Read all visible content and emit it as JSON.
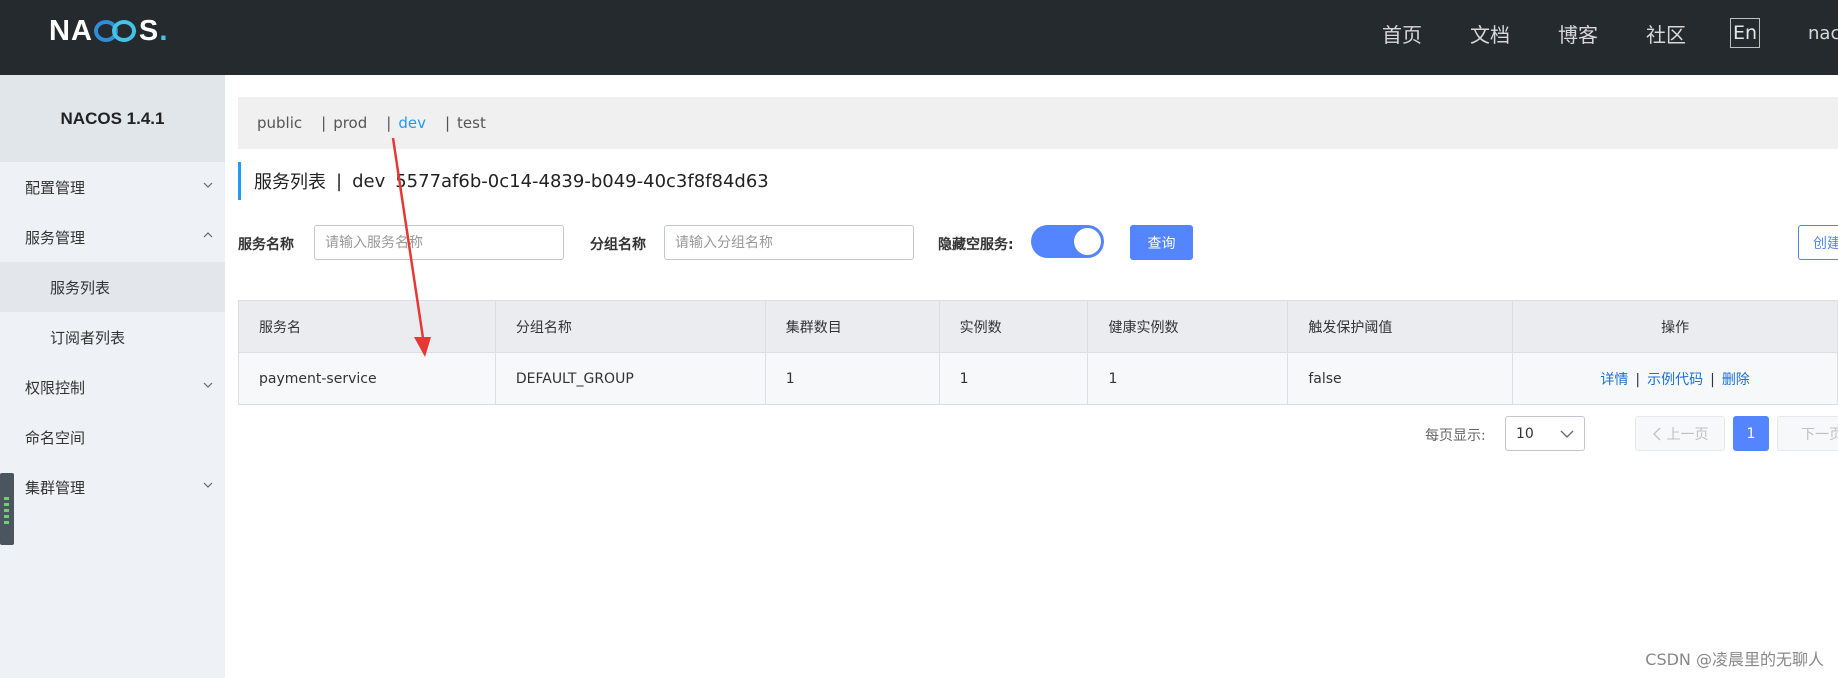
{
  "header": {
    "logo_text": "NACOS.",
    "nav": [
      "首页",
      "文档",
      "博客",
      "社区"
    ],
    "lang": "En",
    "user": "nacos"
  },
  "sidebar": {
    "title": "NACOS 1.4.1",
    "items": [
      {
        "label": "配置管理",
        "level": 1,
        "expanded": false
      },
      {
        "label": "服务管理",
        "level": 1,
        "expanded": true
      },
      {
        "label": "服务列表",
        "level": 2,
        "active": true
      },
      {
        "label": "订阅者列表",
        "level": 2
      },
      {
        "label": "权限控制",
        "level": 1,
        "expanded": false
      },
      {
        "label": "命名空间",
        "level": 1
      },
      {
        "label": "集群管理",
        "level": 1,
        "expanded": false
      }
    ]
  },
  "namespaces": {
    "items": [
      "public",
      "prod",
      "dev",
      "test"
    ],
    "active": "dev"
  },
  "page": {
    "title": "服务列表",
    "namespace_name": "dev",
    "namespace_id": "5577af6b-0c14-4839-b049-40c3f8f84d63"
  },
  "filters": {
    "service_label": "服务名称",
    "service_placeholder": "请输入服务名称",
    "group_label": "分组名称",
    "group_placeholder": "请输入分组名称",
    "hide_empty_label": "隐藏空服务:",
    "hide_empty_on": true,
    "query_button": "查询",
    "create_button": "创建服务"
  },
  "table": {
    "columns": [
      "服务名",
      "分组名称",
      "集群数目",
      "实例数",
      "健康实例数",
      "触发保护阈值",
      "操作"
    ],
    "rows": [
      {
        "service": "payment-service",
        "group": "DEFAULT_GROUP",
        "clusters": "1",
        "instances": "1",
        "healthy": "1",
        "threshold": "false"
      }
    ],
    "actions": [
      "详情",
      "示例代码",
      "删除"
    ]
  },
  "pagination": {
    "page_size_label": "每页显示:",
    "page_size": "10",
    "prev": "上一页",
    "current": "1",
    "next": "下一页"
  },
  "watermark": "CSDN @凌晨里的无聊人",
  "colors": {
    "topbar": "#252a2f",
    "primary": "#5584ff",
    "accent_link": "#209bfa",
    "annotation_arrow": "#e53935"
  }
}
